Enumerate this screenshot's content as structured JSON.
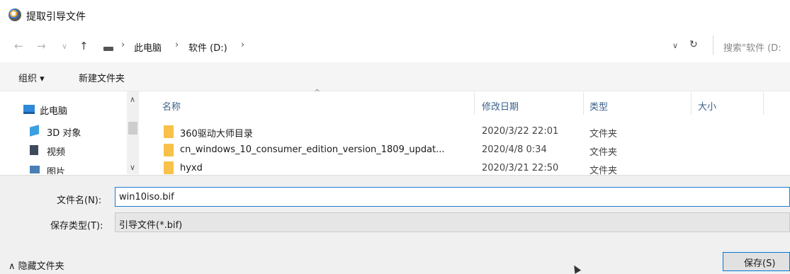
{
  "window": {
    "title": "提取引导文件"
  },
  "address": {
    "back_icon": "←",
    "forward_icon": "→",
    "history_icon": "∨",
    "up_icon": "↑",
    "crumbs": [
      "此电脑",
      "软件 (D:)"
    ],
    "separator": "›",
    "dropdown_icon": "∨",
    "refresh_icon": "↻",
    "search_placeholder": "搜索\"软件 (D:"
  },
  "toolbar": {
    "organize": "组织 ▾",
    "new_folder": "新建文件夹"
  },
  "nav": {
    "items": [
      {
        "label": "此电脑",
        "icon": "computer-icon"
      },
      {
        "label": "3D 对象",
        "icon": "cube-icon"
      },
      {
        "label": "视频",
        "icon": "video-icon"
      },
      {
        "label": "图片",
        "icon": "image-icon"
      }
    ],
    "scroll_up": "∧",
    "scroll_down": "∨"
  },
  "list": {
    "sort_arrow": "^",
    "columns": {
      "name": "名称",
      "date": "修改日期",
      "type": "类型",
      "size": "大小"
    },
    "rows": [
      {
        "name": "360驱动大师目录",
        "date": "2020/3/22 22:01",
        "type": "文件夹"
      },
      {
        "name": "cn_windows_10_consumer_edition_version_1809_updat...",
        "date": "2020/4/8 0:34",
        "type": "文件夹"
      },
      {
        "name": "hyxd",
        "date": "2020/3/21 22:50",
        "type": "文件夹"
      }
    ]
  },
  "save": {
    "filename_label": "文件名(N):",
    "filename_value": "win10iso.bif",
    "filetype_label": "保存类型(T):",
    "filetype_value": "引导文件(*.bif)",
    "hide_folders": "∧ 隐藏文件夹",
    "save_button": "保存(S)"
  },
  "colors": {
    "accent": "#0078d7",
    "folder": "#f7c14a",
    "column_header": "#3a5f8a"
  }
}
